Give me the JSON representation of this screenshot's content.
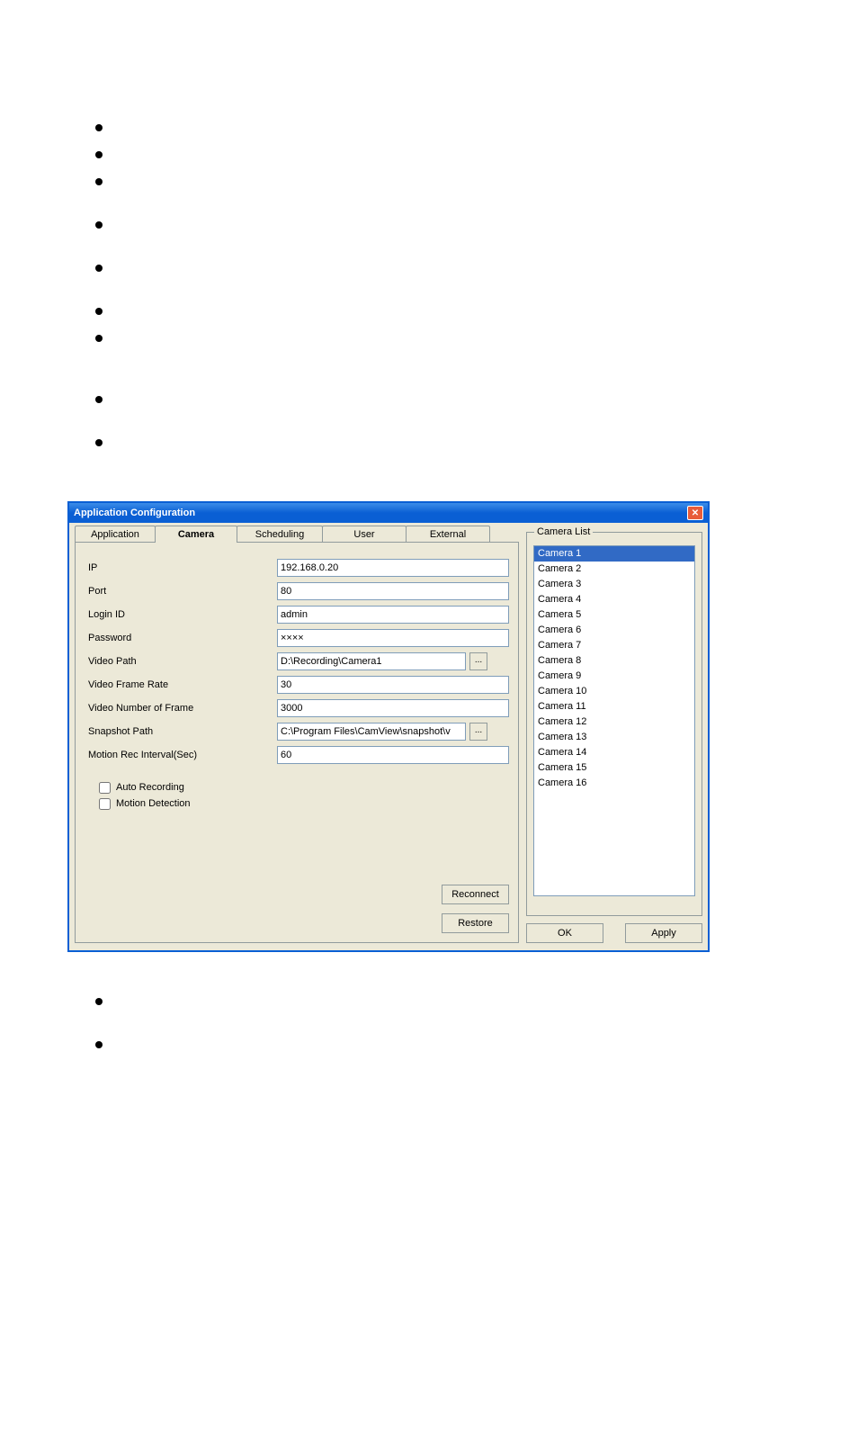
{
  "dialog": {
    "title": "Application Configuration"
  },
  "tabs": [
    {
      "label": "Application"
    },
    {
      "label": "Camera"
    },
    {
      "label": "Scheduling"
    },
    {
      "label": "User"
    },
    {
      "label": "External"
    }
  ],
  "form": {
    "ip_label": "IP",
    "ip_value": "192.168.0.20",
    "port_label": "Port",
    "port_value": "80",
    "login_label": "Login ID",
    "login_value": "admin",
    "password_label": "Password",
    "password_value": "××××",
    "videopath_label": "Video Path",
    "videopath_value": "D:\\Recording\\Camera1",
    "framerate_label": "Video Frame Rate",
    "framerate_value": "30",
    "numframe_label": "Video Number of Frame",
    "numframe_value": "3000",
    "snapshot_label": "Snapshot Path",
    "snapshot_value": "C:\\Program Files\\CamView\\snapshot\\v",
    "motioninterval_label": "Motion Rec Interval(Sec)",
    "motioninterval_value": "60",
    "autorec_label": "Auto Recording",
    "motiondet_label": "Motion Detection",
    "browse_label": "..."
  },
  "buttons": {
    "reconnect": "Reconnect",
    "restore": "Restore",
    "ok": "OK",
    "apply": "Apply"
  },
  "cameraList": {
    "title": "Camera List",
    "items": [
      "Camera 1",
      "Camera 2",
      "Camera 3",
      "Camera 4",
      "Camera 5",
      "Camera 6",
      "Camera 7",
      "Camera 8",
      "Camera 9",
      "Camera 10",
      "Camera 11",
      "Camera 12",
      "Camera 13",
      "Camera 14",
      "Camera 15",
      "Camera 16"
    ]
  }
}
